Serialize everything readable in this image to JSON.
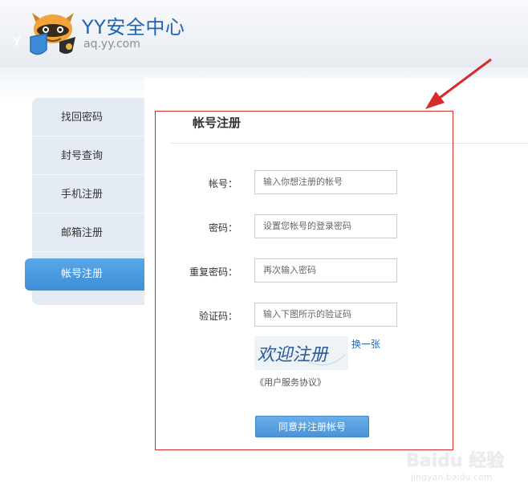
{
  "header": {
    "logo_letter": "Y",
    "title": "YY安全中心",
    "domain": "aq.yy.com"
  },
  "sidebar": {
    "items": [
      {
        "label": "找回密码"
      },
      {
        "label": "封号查询"
      },
      {
        "label": "手机注册"
      },
      {
        "label": "邮箱注册"
      },
      {
        "label": "帐号注册"
      }
    ],
    "active_index": 4
  },
  "form": {
    "title": "帐号注册",
    "fields": [
      {
        "label": "帐号：",
        "placeholder": "输入你想注册的帐号"
      },
      {
        "label": "密码：",
        "placeholder": "设置您帐号的登录密码"
      },
      {
        "label": "重复密码：",
        "placeholder": "再次输入密码"
      },
      {
        "label": "验证码：",
        "placeholder": "输入下图所示的验证码"
      }
    ],
    "captcha_text": "欢迎注册",
    "refresh_label": "换一张",
    "agreement_label": "《用户服务协议》",
    "submit_label": "同意并注册帐号"
  },
  "watermark": {
    "brand": "Baidu 经验",
    "url": "jingyan.baidu.com"
  },
  "colors": {
    "brand_blue": "#1f64b4",
    "active_tab": "#4a9ae0",
    "annotation_red": "#d62b2b"
  }
}
